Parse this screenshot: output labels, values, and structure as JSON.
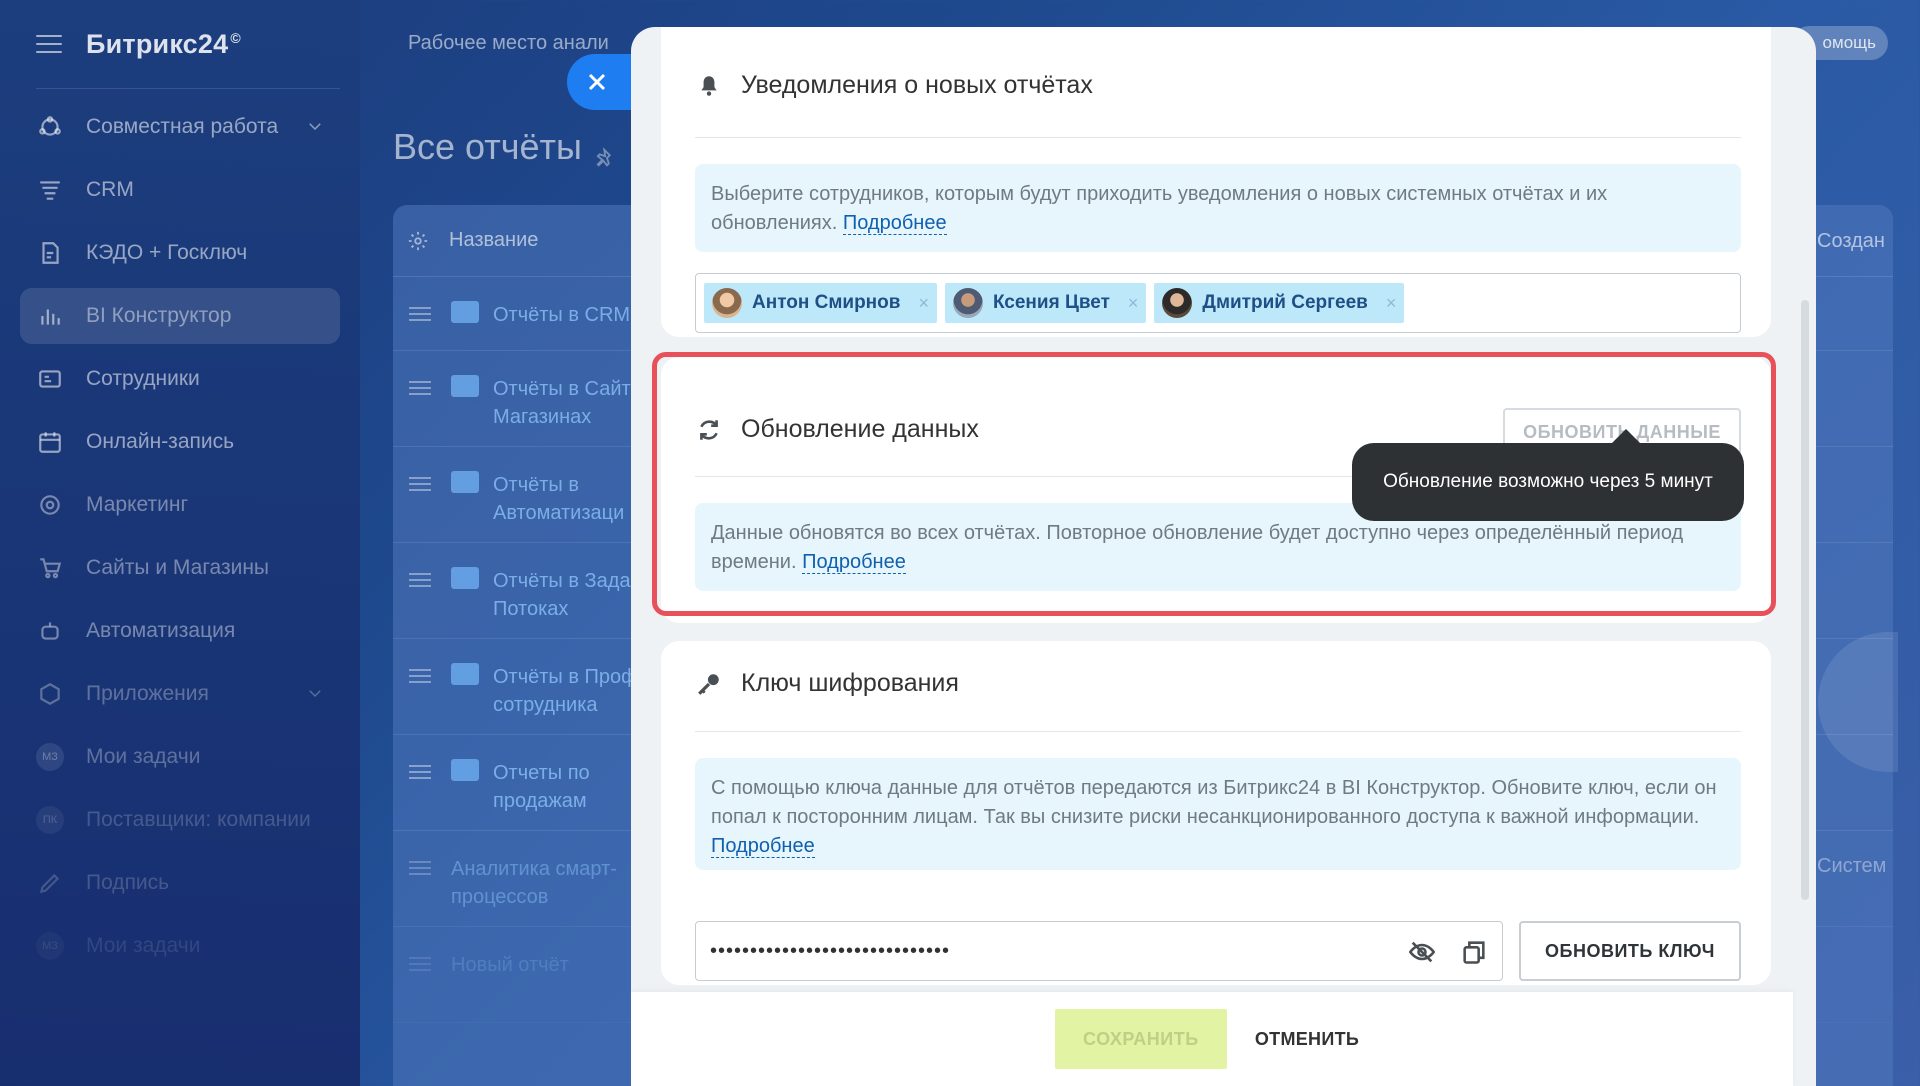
{
  "app": {
    "logo": "Битрикс24",
    "logo_mark": "©",
    "workspace_title": "Рабочее место анали",
    "help_label": "омощь",
    "page_title": "Все отчёты"
  },
  "sidebar": {
    "items": [
      {
        "label": "Совместная работа",
        "icon": "collab-icon"
      },
      {
        "label": "CRM",
        "icon": "crm-icon"
      },
      {
        "label": "КЭДО + Госключ",
        "icon": "document-icon"
      },
      {
        "label": "BI Конструктор",
        "icon": "chart-icon"
      },
      {
        "label": "Сотрудники",
        "icon": "employees-icon"
      },
      {
        "label": "Онлайн-запись",
        "icon": "calendar-icon"
      },
      {
        "label": "Маркетинг",
        "icon": "marketing-icon"
      },
      {
        "label": "Сайты и Магазины",
        "icon": "cart-icon"
      },
      {
        "label": "Автоматизация",
        "icon": "robot-icon"
      },
      {
        "label": "Приложения",
        "icon": "apps-icon"
      },
      {
        "label": "Мои задачи",
        "badge": "МЗ"
      },
      {
        "label": "Поставщики: компании",
        "badge": "ПК"
      },
      {
        "label": "Подпись",
        "icon": "pen-icon"
      },
      {
        "label": "Мои задачи",
        "badge": "МЗ"
      }
    ]
  },
  "grid": {
    "col_name": "Название",
    "col_created": "Создан",
    "rows": [
      {
        "name": "Отчёты в CRM"
      },
      {
        "name": "Отчёты в Сайт Магазинах"
      },
      {
        "name": "Отчёты в Автоматизаци"
      },
      {
        "name": "Отчёты в Зада Потоках"
      },
      {
        "name": "Отчёты в Проф сотрудника"
      },
      {
        "name": "Отчеты по продажам"
      },
      {
        "name": "Аналитика смарт-процессов"
      },
      {
        "name": "Новый отчёт"
      }
    ],
    "system_label": "Систем"
  },
  "notifications": {
    "title": "Уведомления о новых отчётах",
    "info": "Выберите сотрудников, которым будут приходить уведомления о новых системных отчётах и их обновлениях.",
    "more": "Подробнее",
    "users": [
      {
        "name": "Антон Смирнов"
      },
      {
        "name": "Ксения Цвет"
      },
      {
        "name": "Дмитрий Сергеев"
      }
    ],
    "remove_glyph": "×"
  },
  "update": {
    "title": "Обновление данных",
    "button": "ОБНОВИТЬ ДАННЫЕ",
    "info_line1": "Данные обновятся во всех отчётах. Повторное обновление будет доступно через определённый период",
    "info_line2": "времени.",
    "more": "Подробнее",
    "tooltip": "Обновление возможно через 5 минут"
  },
  "encryption": {
    "title": "Ключ шифрования",
    "info": "С помощью ключа данные для отчётов передаются из Битрикс24 в BI Конструктор. Обновите ключ, если он попал к посторонним лицам. Так вы снизите риски несанкционированного доступа к важной информации.",
    "more": "Подробнее",
    "key_value": "••••••••••••••••••••••••••••••",
    "button": "ОБНОВИТЬ КЛЮЧ"
  },
  "footer": {
    "save": "СОХРАНИТЬ",
    "cancel": "ОТМЕНИТЬ"
  },
  "colors": {
    "accent": "#1e7df0",
    "highlight_border": "#e9515a",
    "info_bg": "#e6f6fc",
    "tag_bg": "#bde8fa",
    "save_disabled": "#e2f3a4",
    "tooltip_bg": "#2e3134"
  }
}
